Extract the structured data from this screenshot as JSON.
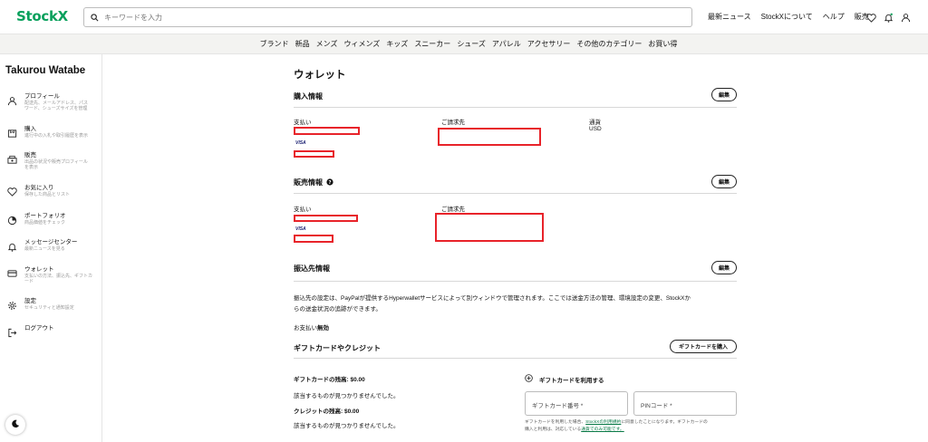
{
  "header": {
    "logo": "StockX",
    "search_placeholder": "キーワードを入力",
    "links": [
      "最新ニュース",
      "StockXについて",
      "ヘルプ",
      "販売"
    ]
  },
  "categories": [
    "ブランド",
    "新品",
    "メンズ",
    "ウィメンズ",
    "キッズ",
    "スニーカー",
    "シューズ",
    "アパレル",
    "アクセサリー",
    "その他のカテゴリー",
    "お買い得"
  ],
  "sidebar": {
    "username": "Takurou Watabe",
    "items": [
      {
        "title": "プロフィール",
        "sub1": "配送先、メールアドレス、パス",
        "sub2": "ワード、シューズサイズを管理"
      },
      {
        "title": "購入",
        "sub1": "進行中の入札や取引履歴を表示",
        "sub2": ""
      },
      {
        "title": "販売",
        "sub1": "出品の状況や販売プロフィール",
        "sub2": "を表示"
      },
      {
        "title": "お気に入り",
        "sub1": "保存した商品とリスト",
        "sub2": ""
      },
      {
        "title": "ポートフォリオ",
        "sub1": "商品価値をチェック",
        "sub2": ""
      },
      {
        "title": "メッセージセンター",
        "sub1": "最新ニュースを見る",
        "sub2": ""
      },
      {
        "title": "ウォレット",
        "sub1": "支払いの方法、振込先、ギフトカ",
        "sub2": "ード"
      },
      {
        "title": "設定",
        "sub1": "セキュリティと通知設定",
        "sub2": ""
      },
      {
        "title": "ログアウト",
        "sub1": "",
        "sub2": ""
      }
    ]
  },
  "wallet": {
    "title": "ウォレット",
    "edit_label": "編集",
    "purchase": {
      "title": "購入情報",
      "payment_label": "支払い",
      "billing_label": "ご請求先",
      "currency_label": "通貨",
      "currency_value": "USD",
      "card_brand": "VISA"
    },
    "sales": {
      "title": "販売情報",
      "payment_label": "支払い",
      "billing_label": "ご請求先",
      "card_brand": "VISA"
    },
    "payout": {
      "title": "振込先情報",
      "desc1": "振込先の設定は、PayPalが提供するHyperwalletサービスによって別ウィンドウで管理されます。ここでは送金方法の管理、環境設定の変更、StockXか",
      "desc2": "らの送金状況の追跡ができます。",
      "status_label": "お支払い",
      "status_value": "無効"
    },
    "gift": {
      "title": "ギフトカードやクレジット",
      "buy_label": "ギフトカードを購入",
      "gift_balance": "ギフトカードの残高: $0.00",
      "gift_none": "該当するものが見つかりませんでした。",
      "credit_balance": "クレジットの残高: $0.00",
      "credit_none": "該当するものが見つかりませんでした。",
      "use_label": "ギフトカードを利用する",
      "card_number_placeholder": "ギフトカード番号 *",
      "pin_placeholder": "PINコード *",
      "terms_pre": "ギフトカードを利用した場合、",
      "terms_link": "StockXの利用規約",
      "terms_post": "に同意したことになります。ギフトカードの",
      "terms_line2_pre": "購入と利用は、対応している",
      "terms_line2_link": "通貨でのみ可能です。"
    }
  },
  "colors": {
    "brand": "#08a05c",
    "redaction": "#e8232a"
  }
}
